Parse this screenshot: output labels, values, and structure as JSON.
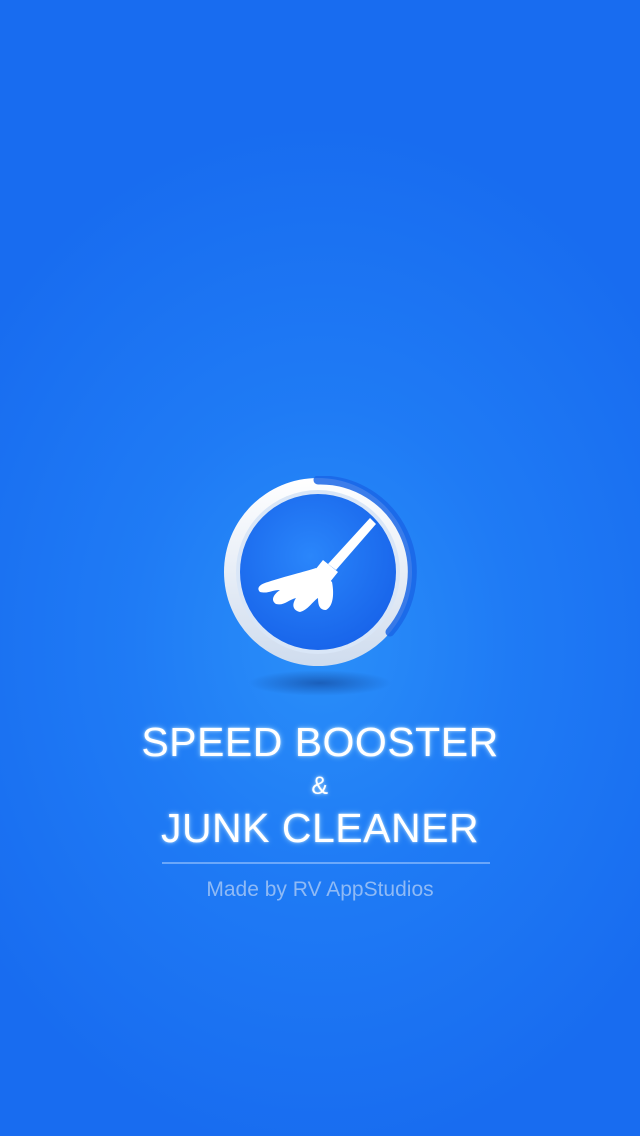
{
  "splash": {
    "title_line1": "SPEED BOOSTER",
    "ampersand": "&",
    "title_line2": "JUNK CLEANER",
    "credit": "Made by RV AppStudios"
  },
  "logo": {
    "icon": "broom-icon"
  },
  "colors": {
    "background": "#1f7bf5",
    "logo_inner": "#1c6ff0",
    "logo_ring": "#eef3fa",
    "progress_arc": "#1a66e6",
    "credit_text": "#8fbaf5"
  }
}
